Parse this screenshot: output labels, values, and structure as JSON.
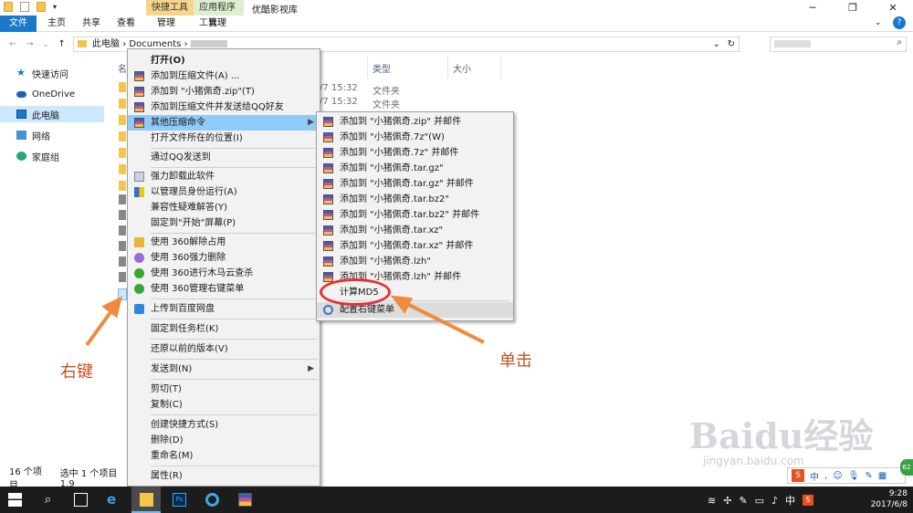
{
  "window": {
    "title": "优酷影视库",
    "context_tabs": [
      "快捷工具",
      "应用程序工具"
    ]
  },
  "ribbon": {
    "tabs": [
      "文件",
      "主页",
      "共享",
      "查看",
      "管理",
      "管理"
    ]
  },
  "address": {
    "breadcrumb": [
      "此电脑",
      "Documents"
    ]
  },
  "nav": {
    "items": [
      "快速访问",
      "OneDrive",
      "此电脑",
      "网络",
      "家庭组"
    ]
  },
  "filelist": {
    "columns": [
      "名",
      "类型",
      "大小"
    ],
    "rows": [
      {
        "date": "/7 15:32",
        "type": "文件夹"
      },
      {
        "date": "/7 15:32",
        "type": "文件夹"
      }
    ]
  },
  "context_menu": {
    "items": [
      {
        "label": "打开(O)",
        "bold": true
      },
      {
        "label": "添加到压缩文件(A) ..."
      },
      {
        "label": "添加到 \"小猪佩奇.zip\"(T)"
      },
      {
        "label": "添加到压缩文件并发送给QQ好友"
      },
      {
        "label": "其他压缩命令",
        "submenu": true
      },
      {
        "label": "打开文件所在的位置(I)"
      },
      {
        "label": "通过QQ发送到"
      },
      {
        "label": "强力卸载此软件"
      },
      {
        "label": "以管理员身份运行(A)"
      },
      {
        "label": "兼容性疑难解答(Y)"
      },
      {
        "label": "固定到\"开始\"屏幕(P)"
      },
      {
        "label": "使用 360解除占用"
      },
      {
        "label": "使用 360强力删除"
      },
      {
        "label": "使用 360进行木马云查杀"
      },
      {
        "label": "使用 360管理右键菜单"
      },
      {
        "label": "上传到百度网盘"
      },
      {
        "label": "固定到任务栏(K)"
      },
      {
        "label": "还原以前的版本(V)"
      },
      {
        "label": "发送到(N)",
        "submenu": true
      },
      {
        "label": "剪切(T)"
      },
      {
        "label": "复制(C)"
      },
      {
        "label": "创建快捷方式(S)"
      },
      {
        "label": "删除(D)"
      },
      {
        "label": "重命名(M)"
      },
      {
        "label": "属性(R)"
      }
    ]
  },
  "submenu": {
    "items": [
      "添加到 \"小猪佩奇.zip\" 并邮件",
      "添加到 \"小猪佩奇.7z\"(W)",
      "添加到 \"小猪佩奇.7z\" 并邮件",
      "添加到 \"小猪佩奇.tar.gz\"",
      "添加到 \"小猪佩奇.tar.gz\" 并邮件",
      "添加到 \"小猪佩奇.tar.bz2\"",
      "添加到 \"小猪佩奇.tar.bz2\" 并邮件",
      "添加到 \"小猪佩奇.tar.xz\"",
      "添加到 \"小猪佩奇.tar.xz\" 并邮件",
      "添加到 \"小猪佩奇.lzh\"",
      "添加到 \"小猪佩奇.lzh\" 并邮件",
      "计算MD5",
      "配置右键菜单"
    ]
  },
  "annotations": {
    "right_click": "右键",
    "click": "单击"
  },
  "status": {
    "count": "16 个项目",
    "selected": "选中 1 个项目 1.9"
  },
  "taskbar": {
    "time": "9:28",
    "date": "2017/6/8",
    "ime_lang": "中",
    "badge": "62"
  },
  "watermark": {
    "brand": "Baidu经验",
    "url": "jingyan.baidu.com"
  }
}
